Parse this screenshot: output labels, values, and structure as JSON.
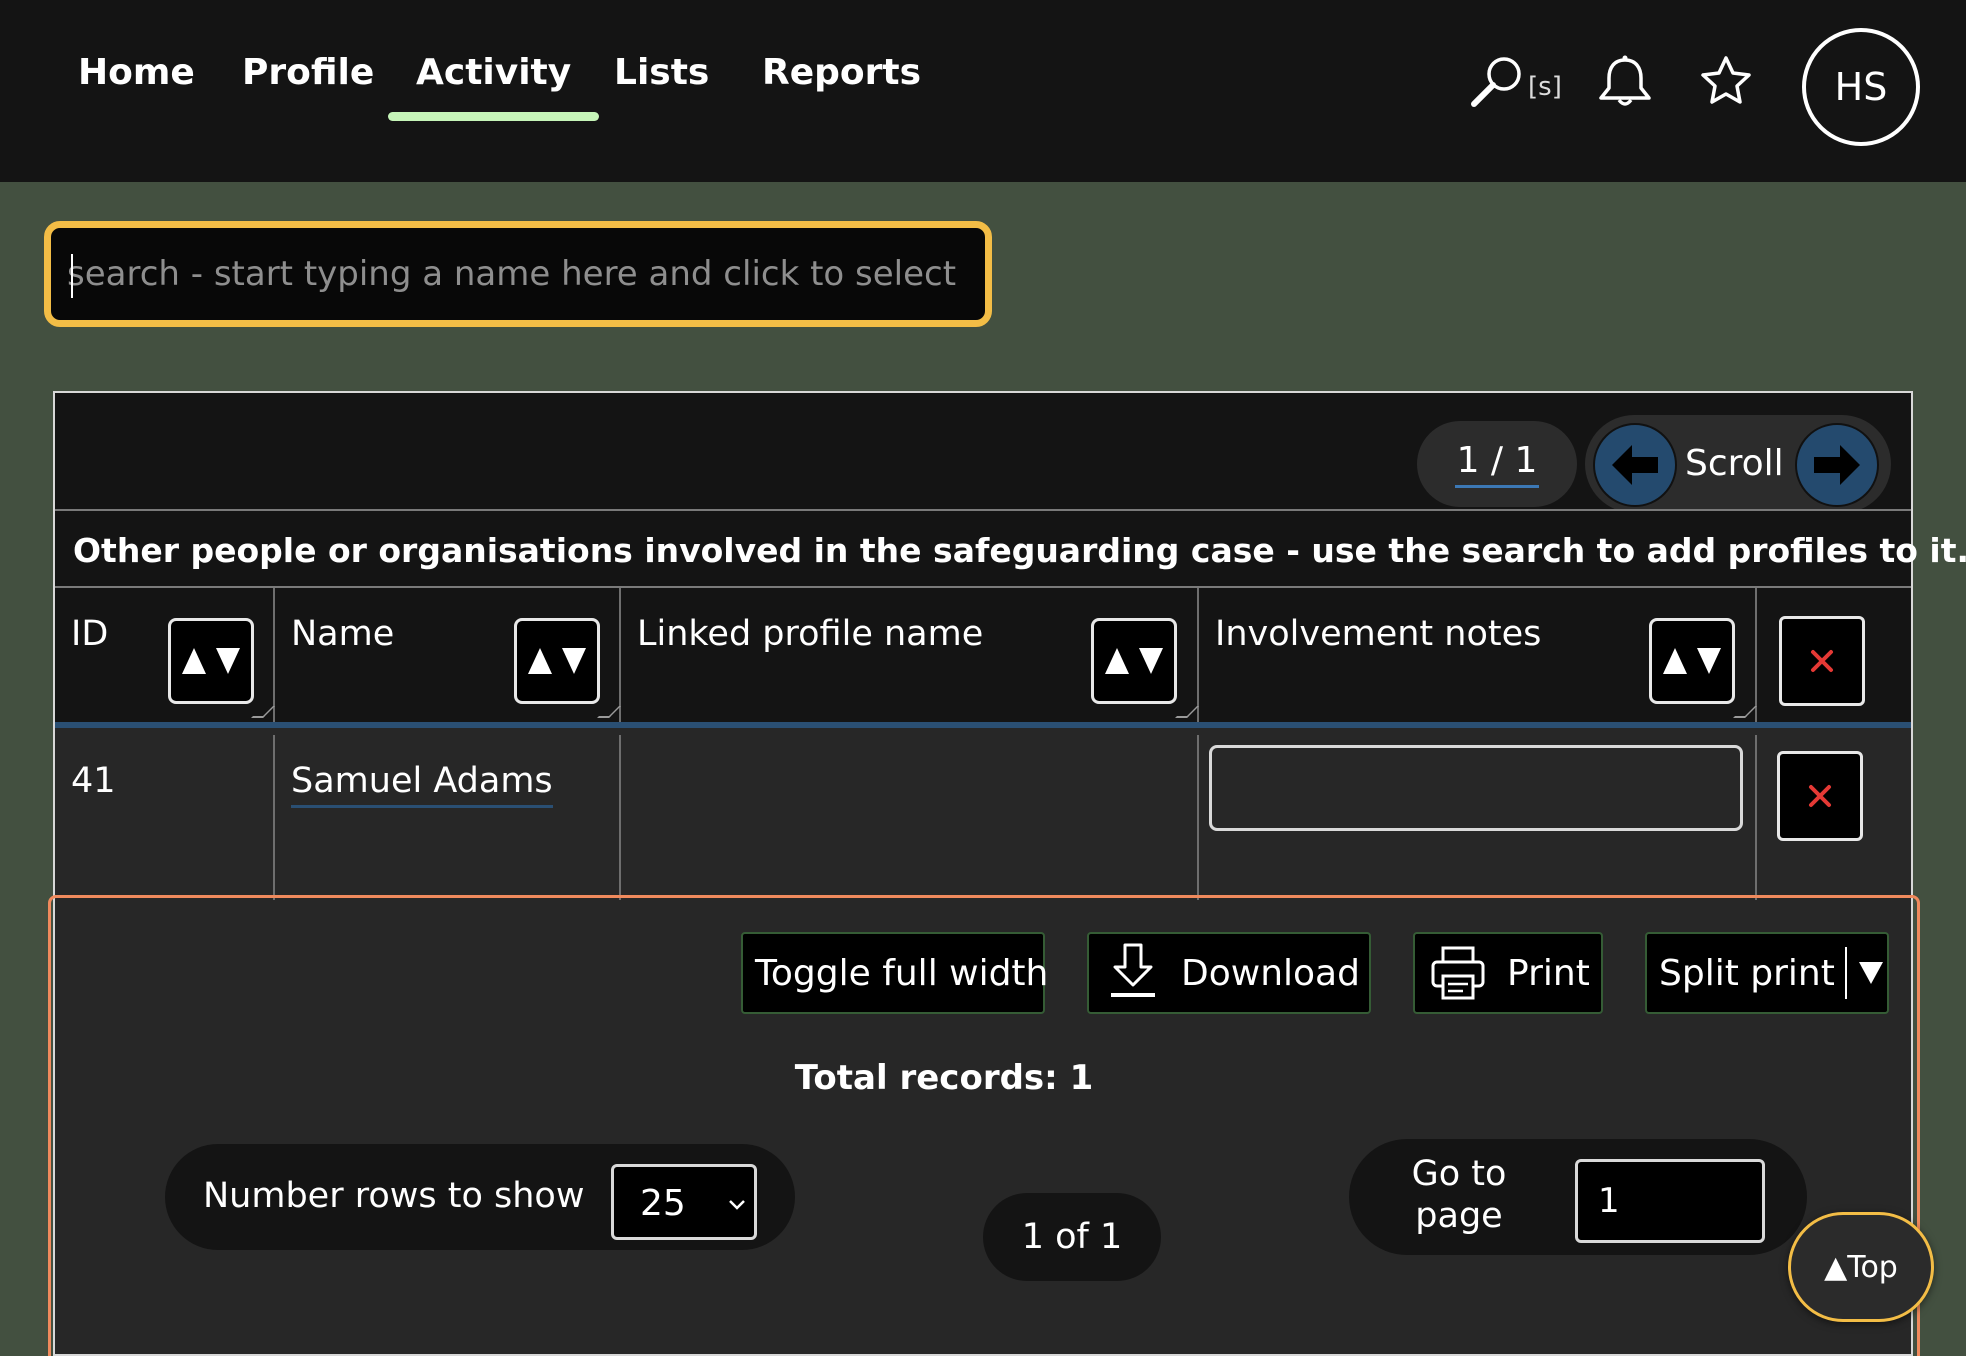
{
  "nav": {
    "items": [
      {
        "label": "Home"
      },
      {
        "label": "Profile"
      },
      {
        "label": "Activity",
        "active": true
      },
      {
        "label": "Lists"
      },
      {
        "label": "Reports"
      }
    ],
    "search_hotkey": "[s]",
    "icons": [
      "search-icon",
      "bell-icon",
      "star-icon"
    ],
    "avatar_initials": "HS",
    "accent_color": "#c6f5b8"
  },
  "search": {
    "placeholder": "search - start typing a name here and click to select",
    "value": "",
    "focus_color": "#f3bd46"
  },
  "table": {
    "page_indicator": "1 / 1",
    "scroll_label": "Scroll",
    "caption": "Other people or organisations involved in the safeguarding case - use the search to add profiles to it.",
    "columns": [
      {
        "label": "ID"
      },
      {
        "label": "Name"
      },
      {
        "label": "Linked profile name"
      },
      {
        "label": "Involvement notes"
      }
    ],
    "rows": [
      {
        "id": "41",
        "name": "Samuel Adams",
        "linked_profile_name": "",
        "involvement_notes": ""
      }
    ],
    "delete_icon_color": "#e53935"
  },
  "footer": {
    "toggle_label": "Toggle full width",
    "download_label": "Download",
    "print_label": "Print",
    "split_print_label": "Split print",
    "total_records": "Total records: 1",
    "rows_label": "Number rows to show",
    "rows_value": "25",
    "page_of": "1 of 1",
    "goto_label": "Go to page",
    "goto_value": "1",
    "top_label": "▲Top"
  }
}
